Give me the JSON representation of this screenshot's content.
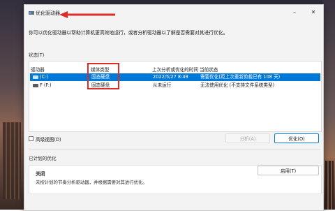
{
  "window": {
    "title": "优化驱动器"
  },
  "description": "你可以优化驱动器以帮助计算机更高效地运行，或者分析驱动器以了解是否需要对其进行优化。",
  "status_section": {
    "label": "状态(T)"
  },
  "columns": [
    "驱动器",
    "媒体类型",
    "上次分析或优化的时间",
    "当前状态"
  ],
  "drives": [
    {
      "drive": "(C:)",
      "media": "固态硬盘",
      "last_run": "2022/5/27 8:49",
      "status": "需要优化(距上次重新剪裁已有 108 天)",
      "selected": true
    },
    {
      "drive": "F (F:)",
      "media": "固态硬盘",
      "last_run": "从未运行",
      "status": "无法使用优化 (不支持文件系统类型)",
      "selected": false
    }
  ],
  "advanced_view": {
    "label": "高级视图(D)",
    "checked": false
  },
  "buttons": {
    "analyze": "分析(A)",
    "optimize": "优化(O)",
    "enable": "启用(T)"
  },
  "scheduled": {
    "label": "已计划的优化",
    "status": "关闭",
    "description": "未按计划的节奏分析驱动器，并根据需要对其进行优化。"
  },
  "colors": {
    "accent": "#0078d7",
    "highlight_box": "#e02b2b"
  }
}
